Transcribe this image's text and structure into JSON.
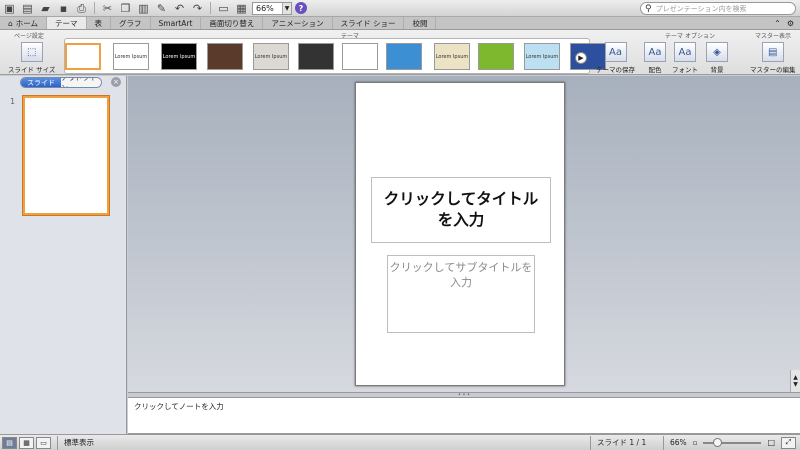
{
  "toolbar": {
    "zoom": "66%",
    "help": "?"
  },
  "search": {
    "placeholder": "プレゼンテーション内を検索"
  },
  "tabs": [
    {
      "label": "ホーム"
    },
    {
      "label": "テーマ"
    },
    {
      "label": "表"
    },
    {
      "label": "グラフ"
    },
    {
      "label": "SmartArt"
    },
    {
      "label": "画面切り替え"
    },
    {
      "label": "アニメーション"
    },
    {
      "label": "スライド ショー"
    },
    {
      "label": "校閲"
    }
  ],
  "ribbon": {
    "groups": {
      "page_setup": "ページ設定",
      "themes": "テーマ",
      "theme_options": "テーマ オプション",
      "master": "マスター表示"
    },
    "slide_size": "スライド サイズ",
    "save_theme": "テーマの保存",
    "colors": "配色",
    "fonts": "フォント",
    "background": "背景",
    "edit_master": "マスターの編集",
    "themes": [
      {
        "text": "",
        "bg": "#ffffff"
      },
      {
        "text": "Lorem Ipsum",
        "bg": "#ffffff"
      },
      {
        "text": "Lorem Ipsum",
        "bg": "#000000"
      },
      {
        "text": "",
        "bg": "#5a3a2a"
      },
      {
        "text": "Lorem Ipsum",
        "bg": "#dcd9d4"
      },
      {
        "text": "",
        "bg": "#333333"
      },
      {
        "text": "",
        "bg": "#ffffff"
      },
      {
        "text": "",
        "bg": "#3d8fd4"
      },
      {
        "text": "Lorem Ipsum",
        "bg": "#ece3c4"
      },
      {
        "text": "",
        "bg": "#7db82e"
      },
      {
        "text": "Lorem Ipsum",
        "bg": "#bcdff2"
      },
      {
        "text": "",
        "bg": "#2c4f9e"
      }
    ]
  },
  "panel": {
    "tab_slides": "スライド",
    "tab_outline": "アウトライン",
    "slide_number": "1"
  },
  "slide": {
    "title": "クリックしてタイトルを入力",
    "subtitle": "クリックしてサブタイトルを入力"
  },
  "notes": {
    "placeholder": "クリックしてノートを入力"
  },
  "status": {
    "view_name": "標準表示",
    "slide_counter": "スライド 1 / 1",
    "zoom": "66%"
  }
}
